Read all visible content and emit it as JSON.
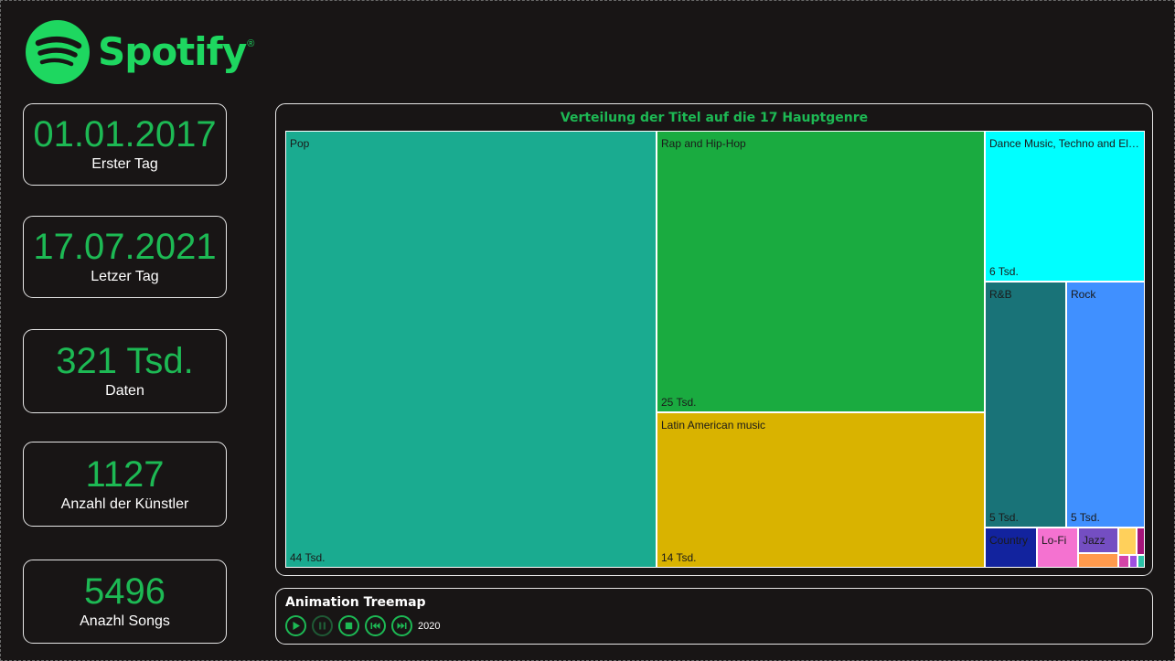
{
  "brand": {
    "name": "Spotify",
    "reg": "®",
    "color": "#1ed760",
    "icon": "spotify-logo-icon"
  },
  "kpis": [
    {
      "value": "01.01.2017",
      "label": "Erster Tag"
    },
    {
      "value": "17.07.2021",
      "label": "Letzer Tag"
    },
    {
      "value": "321 Tsd.",
      "label": "Daten"
    },
    {
      "value": "1127",
      "label": "Anzahl der Künstler"
    },
    {
      "value": "5496",
      "label": "Anazhl Songs"
    }
  ],
  "treemap": {
    "title": "Verteilung der Titel auf die 17 Hauptgenre",
    "tiles": [
      {
        "name": "Pop",
        "value": "44 Tsd.",
        "color": "#1aab90"
      },
      {
        "name": "Rap and Hip-Hop",
        "value": "25 Tsd.",
        "color": "#1aab40"
      },
      {
        "name": "Latin American music",
        "value": "14 Tsd.",
        "color": "#d9b300"
      },
      {
        "name": "Dance Music, Techno and Electronic Music",
        "value": "6 Tsd.",
        "color": "#00ffff"
      },
      {
        "name": "R&B",
        "value": "5 Tsd.",
        "color": "#197378"
      },
      {
        "name": "Rock",
        "value": "5 Tsd.",
        "color": "#4090ff"
      },
      {
        "name": "Country",
        "value": "",
        "color": "#12239e"
      },
      {
        "name": "Lo-Fi",
        "value": "",
        "color": "#f472d0"
      },
      {
        "name": "Jazz",
        "value": "",
        "color": "#744ec2"
      },
      {
        "name": "",
        "value": "",
        "color": "#ffd05b"
      },
      {
        "name": "",
        "value": "",
        "color": "#a6157b"
      },
      {
        "name": "",
        "value": "",
        "color": "#ff9a4d"
      },
      {
        "name": "",
        "value": "",
        "color": "#d444a8"
      },
      {
        "name": "",
        "value": "",
        "color": "#9f4fe0"
      },
      {
        "name": "",
        "value": "",
        "color": "#2cc2a8"
      }
    ]
  },
  "animation": {
    "title": "Animation Treemap",
    "year": "2020",
    "controls": [
      "play",
      "pause",
      "stop",
      "previous",
      "next"
    ],
    "accent": "#1db954"
  }
}
